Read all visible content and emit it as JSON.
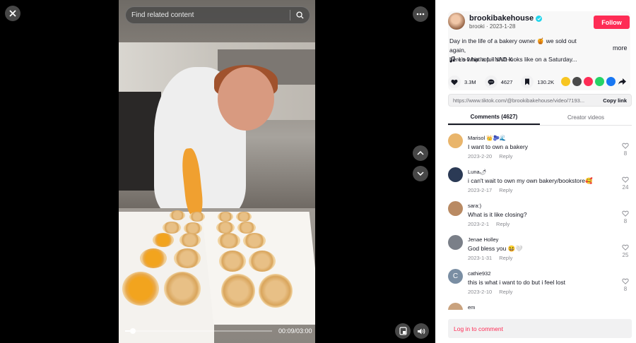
{
  "search": {
    "placeholder": "Find related content"
  },
  "player": {
    "time": "00:09/03:00",
    "progress_fraction": 0.05
  },
  "author": {
    "username": "brookibakehouse",
    "handle": "brooki",
    "date": "2023-1-28",
    "follow_label": "Follow",
    "description_line1": "Day in the life of a bakery owner 🍯 we sold out again,",
    "description_line2": "here's what a full shift looks like on a Saturday...",
    "more_label": "more",
    "music": "Lo-fi hip hop - NAO-K"
  },
  "stats": {
    "likes": "3.3M",
    "comments": "4627",
    "saves": "130.2K"
  },
  "link": {
    "url": "https://www.tiktok.com/@brookibakehouse/video/7193...",
    "copy_label": "Copy link"
  },
  "tabs": {
    "comments": "Comments (4627)",
    "creator": "Creator videos"
  },
  "comments": [
    {
      "name": "Marisol 👑🫐🌊",
      "text": "I want to own a bakery",
      "date": "2023-2-20",
      "reply": "Reply",
      "likes": "8",
      "avatar_color": "#e9b56b"
    },
    {
      "name": "Luna🌶",
      "text": "i can't wait to own my own bakery/bookstore🥰",
      "date": "2023-2-17",
      "reply": "Reply",
      "likes": "24",
      "avatar_color": "#2b3a55"
    },
    {
      "name": "sara:)",
      "text": "What is it like closing?",
      "date": "2023-2-1",
      "reply": "Reply",
      "likes": "8",
      "avatar_color": "#b98a63"
    },
    {
      "name": "Jenae Holley",
      "text": "God bless you 😆🤍",
      "date": "2023-1-31",
      "reply": "Reply",
      "likes": "25",
      "avatar_color": "#7a7f88"
    },
    {
      "name": "cathie932",
      "text": "this is what i want to do but i feel lost",
      "date": "2023-2-10",
      "reply": "Reply",
      "likes": "8",
      "avatar_color": "#7a8ea3",
      "avatar_letter": "C"
    },
    {
      "name": "em",
      "text": "",
      "date": "",
      "reply": "",
      "likes": "",
      "avatar_color": "#c9a27e"
    }
  ],
  "login": {
    "label": "Log in to comment"
  },
  "colors": {
    "accent": "#fe2c55",
    "verified": "#20d5ec"
  }
}
